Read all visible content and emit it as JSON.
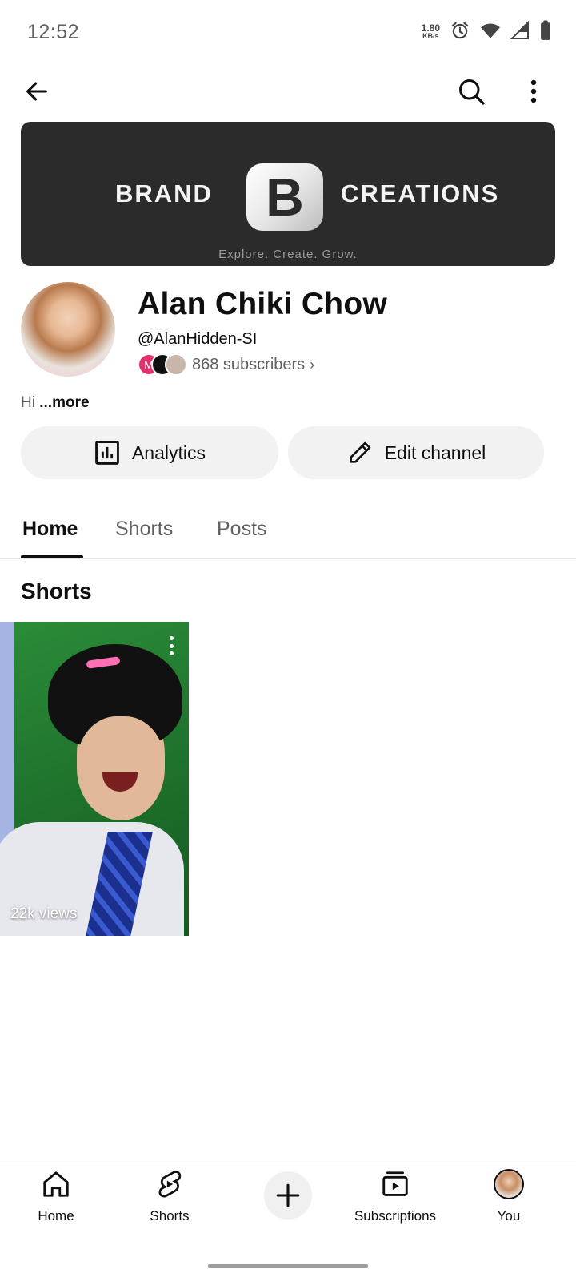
{
  "status_bar": {
    "time": "12:52",
    "net_speed_value": "1.80",
    "net_speed_unit": "KB/s",
    "icons": [
      "alarm-icon",
      "wifi-icon",
      "signal-icon",
      "battery-icon"
    ]
  },
  "top_bar": {
    "icons": [
      "back-arrow-icon",
      "search-icon",
      "more-vert-icon"
    ]
  },
  "banner": {
    "left_text": "BRAND",
    "logo_letter": "B",
    "right_text": "CREATIONS",
    "tagline": "Explore. Create. Grow."
  },
  "channel": {
    "name": "Alan Chiki Chow",
    "handle": "@AlanHidden-SI",
    "subscriber_avatar_letter": "M",
    "subscribers": "868 subscribers",
    "subscribers_chevron": "›",
    "description": "Hi",
    "more_label": "...more"
  },
  "actions": {
    "analytics_label": "Analytics",
    "edit_label": "Edit channel"
  },
  "tabs": {
    "items": [
      {
        "label": "Home",
        "active": true
      },
      {
        "label": "Shorts",
        "active": false
      },
      {
        "label": "Posts",
        "active": false
      }
    ]
  },
  "section": {
    "title": "Shorts"
  },
  "shorts": [
    {
      "views": "22k views"
    }
  ],
  "bottom_nav": {
    "items": [
      {
        "label": "Home",
        "icon": "home-icon"
      },
      {
        "label": "Shorts",
        "icon": "shorts-icon"
      },
      {
        "label": "",
        "icon": "create-plus-icon"
      },
      {
        "label": "Subscriptions",
        "icon": "subscriptions-icon"
      },
      {
        "label": "You",
        "icon": "you-avatar-icon"
      }
    ]
  },
  "colors": {
    "accent_text": "#0f0f0f",
    "secondary_text": "#606060",
    "button_bg": "#f2f2f2",
    "banner_bg": "#2b2b2b"
  }
}
